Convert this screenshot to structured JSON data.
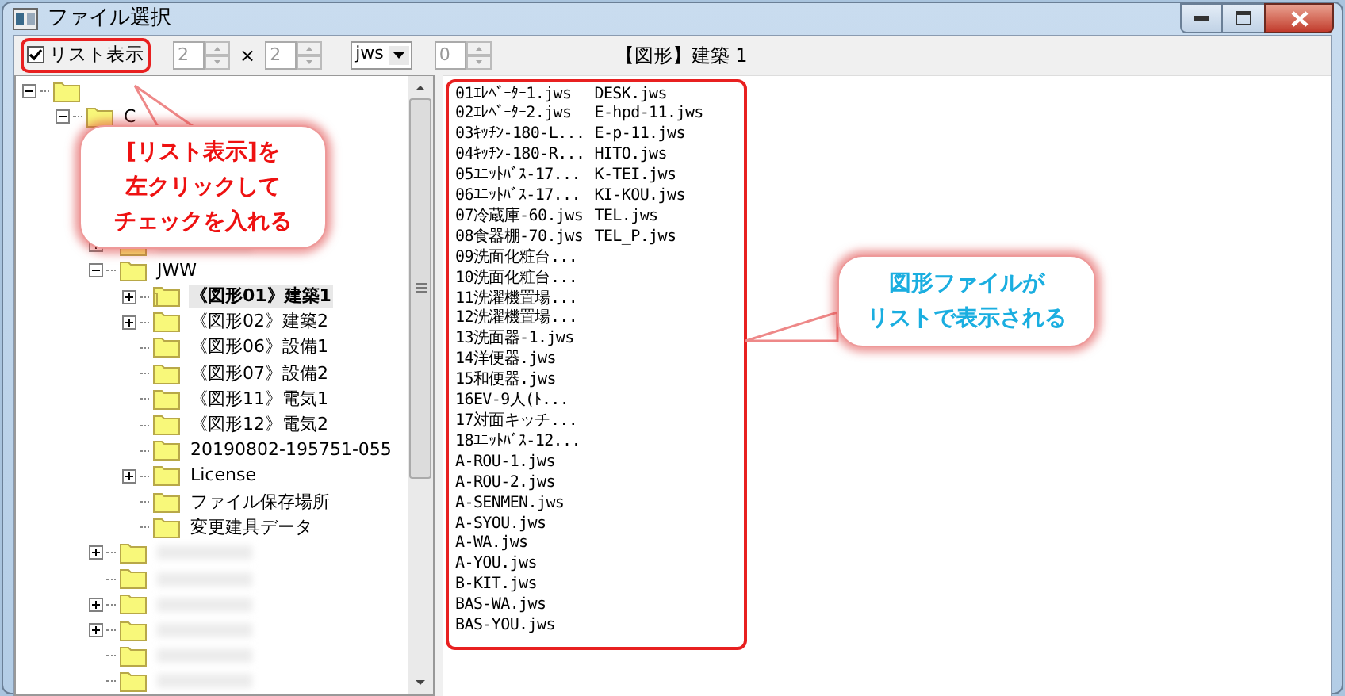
{
  "window": {
    "title": "ファイル選択"
  },
  "toolbar": {
    "list_view": {
      "label": "リスト表示",
      "checked": true
    },
    "columns_spinner": {
      "value": "2",
      "disabled": true
    },
    "times": "×",
    "rows_spinner": {
      "value": "2",
      "disabled": true
    },
    "extension": {
      "value": "jws"
    },
    "offset_spinner": {
      "value": "0",
      "disabled": true
    },
    "heading": "【図形】建築 1"
  },
  "tree": [
    {
      "expanded": true,
      "children": [
        {
          "label": "C",
          "expanded": true,
          "children": [
            {
              "kind": "hidden"
            },
            {
              "kind": "hidden"
            },
            {
              "kind": "hidden"
            },
            {
              "kind": "hidden"
            },
            {
              "kind": "redacted",
              "expandable": true
            },
            {
              "label": "JWW",
              "expanded": true,
              "children": [
                {
                  "label": "《図形01》建築1",
                  "selected": true,
                  "expandable": true
                },
                {
                  "label": "《図形02》建築2",
                  "selected": false,
                  "expandable": true
                },
                {
                  "label": "《図形06》設備1",
                  "selected": false
                },
                {
                  "label": "《図形07》設備2",
                  "selected": false
                },
                {
                  "label": "《図形11》電気1",
                  "selected": false
                },
                {
                  "label": "《図形12》電気2",
                  "selected": false
                },
                {
                  "label": "20190802-195751-055",
                  "selected": false
                },
                {
                  "label": "License",
                  "selected": false,
                  "expandable": true
                },
                {
                  "label": "ファイル保存場所",
                  "selected": false
                },
                {
                  "label": "変更建具データ",
                  "selected": false
                }
              ]
            },
            {
              "kind": "redacted",
              "expandable": true
            },
            {
              "kind": "redacted"
            },
            {
              "kind": "redacted",
              "expandable": true
            },
            {
              "kind": "redacted",
              "expandable": true
            },
            {
              "kind": "redacted"
            },
            {
              "kind": "redacted"
            }
          ]
        }
      ]
    }
  ],
  "file_list": {
    "columns": [
      [
        "01ｴﾚﾍﾞｰﾀｰ1.jws",
        "02ｴﾚﾍﾞｰﾀｰ2.jws",
        "03ｷｯﾁﾝ-180-L...",
        "04ｷｯﾁﾝ-180-R...",
        "05ﾕﾆｯﾄﾊﾞｽ-17...",
        "06ﾕﾆｯﾄﾊﾞｽ-17...",
        "07冷蔵庫-60.jws",
        "08食器棚-70.jws",
        "09洗面化粧台...",
        "10洗面化粧台...",
        "11洗濯機置場...",
        "12洗濯機置場...",
        "13洗面器-1.jws",
        "14洋便器.jws",
        "15和便器.jws",
        "16EV-9人(ﾄ...",
        "17対面キッチ...",
        "18ﾕﾆｯﾄﾊﾞｽ-12...",
        "A-ROU-1.jws",
        "A-ROU-2.jws",
        "A-SENMEN.jws",
        "A-SYOU.jws",
        "A-WA.jws",
        "A-YOU.jws",
        "B-KIT.jws",
        "BAS-WA.jws",
        "BAS-YOU.jws"
      ],
      [
        "DESK.jws",
        "E-hpd-11.jws",
        "E-p-11.jws",
        "HITO.jws",
        "K-TEI.jws",
        "KI-KOU.jws",
        "TEL.jws",
        "TEL_P.jws"
      ]
    ]
  },
  "callouts": [
    {
      "kind": "red",
      "lines": [
        "[リスト表示]を",
        "左クリックして",
        "チェックを入れる"
      ]
    },
    {
      "kind": "blue",
      "lines": [
        "図形ファイルが",
        "リストで表示される"
      ]
    }
  ]
}
